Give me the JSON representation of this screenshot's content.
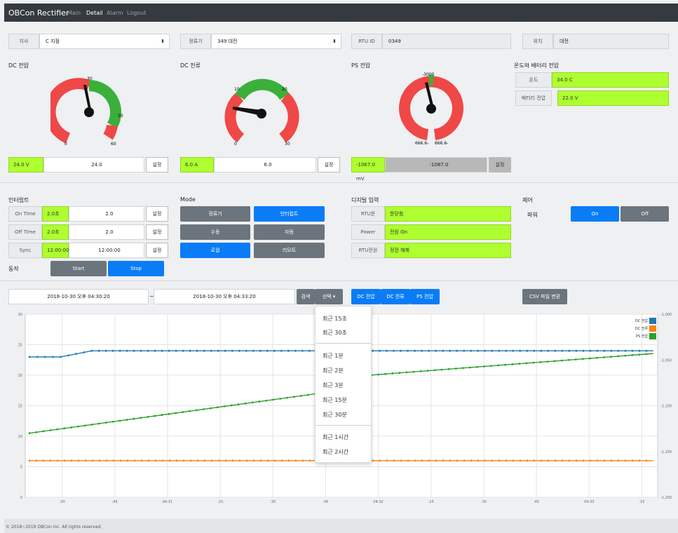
{
  "nav": {
    "brand": "OBCon Rectifier",
    "main": "Main",
    "detail": "Detail",
    "alarm": "Alarm",
    "logout": "Logout"
  },
  "filters": {
    "branch_label": "지사",
    "branch_value": "C 지점",
    "rect_label": "정류기",
    "rect_value": "349 대전",
    "rtu_label": "RTU ID",
    "rtu_value": "0349",
    "loc_label": "위치",
    "loc_value": "대전"
  },
  "gauges": {
    "dc_voltage": {
      "title": "DC 전압",
      "ticks": [
        "30",
        "50",
        "60",
        "0"
      ],
      "readout": "24.0 V",
      "input": "24.0",
      "set": "설정",
      "value": 24,
      "min": 0,
      "max": 60
    },
    "dc_current": {
      "title": "DC 전류",
      "ticks": [
        "10",
        "20",
        "30",
        "0"
      ],
      "readout": "6.0 A",
      "input": "6.0",
      "set": "설정",
      "value": 6,
      "min": 0,
      "max": 30
    },
    "ps_voltage": {
      "title": "PS 전압",
      "ticks": [
        "-3000",
        "666.6-",
        "666.6-"
      ],
      "readout": "-1067.0 mV",
      "input": "-1087.0",
      "set": "설정"
    }
  },
  "temp": {
    "title": "온도와 배터리 전압",
    "temp_label": "온도",
    "temp_value": "34.0 C",
    "batt_label": "배터리 전압",
    "batt_value": "22.0 V"
  },
  "interrupt": {
    "title": "인터럽트",
    "rows": [
      {
        "label": "On Time",
        "badge": "2.0초",
        "value": "2.0",
        "set": "설정"
      },
      {
        "label": "Off Time",
        "badge": "2.0초",
        "value": "2.0",
        "set": "설정"
      },
      {
        "label": "Sync",
        "badge": "12:00:00",
        "value": "12:00:00",
        "set": "설정"
      }
    ],
    "op_label": "동작",
    "start": "Start",
    "stop": "Stop"
  },
  "mode": {
    "title": "Mode",
    "b1": "정류기",
    "b2": "인터럽트",
    "b3": "수동",
    "b4": "자동",
    "b5": "로컬",
    "b6": "리모트"
  },
  "digital": {
    "title": "디지털 입력",
    "rows": [
      {
        "label": "RTU문",
        "value": "문닫힘"
      },
      {
        "label": "Power",
        "value": "전원 On"
      },
      {
        "label": "RTU전원",
        "value": "정전 해제"
      }
    ]
  },
  "control": {
    "title": "제어",
    "label": "파워",
    "on": "On",
    "off": "Off"
  },
  "range": {
    "start": "2018-10-30 오후 04:30:20",
    "sep": "~",
    "end": "2018-10-30 오후 04:33:20",
    "search": "검색",
    "select": "선택 ▾",
    "dc_v": "DC 전압",
    "dc_c": "DC 전류",
    "ps_v": "PS 전압",
    "csv": "CSV 파일 변환"
  },
  "dropdown": {
    "g1": [
      "최근 15초",
      "최근 30초"
    ],
    "g2": [
      "최근 1분",
      "최근 2분",
      "최근 3분",
      "최근 15분",
      "최근 30분"
    ],
    "g3": [
      "최근 1시간",
      "최근 2시간"
    ]
  },
  "footer": "© 2018~2019 OBCon Inc. All rights reserved.",
  "chart_data": {
    "type": "line",
    "x_ticks": [
      ":30",
      ":45",
      "04:31",
      ":15",
      ":30",
      ":45",
      "04:32",
      ":15",
      ":30",
      ":45",
      "04:33",
      ":15"
    ],
    "ylim": [
      0,
      30
    ],
    "yticks": [
      0,
      5,
      10,
      15,
      20,
      25,
      30
    ],
    "y2lim": [
      -1200,
      -1000
    ],
    "y2ticks": [
      "-1,000",
      "-1,050",
      "-1,100",
      "-1,150",
      "-1,200"
    ],
    "legend": "top-right",
    "series": [
      {
        "name": "DC 전압",
        "color": "#1f77b4",
        "axis": "left",
        "points": [
          [
            0,
            23
          ],
          [
            5,
            23
          ],
          [
            10,
            24
          ],
          [
            100,
            24
          ]
        ]
      },
      {
        "name": "DC 전류",
        "color": "#ff7f0e",
        "axis": "left",
        "points": [
          [
            0,
            6
          ],
          [
            100,
            6
          ]
        ]
      },
      {
        "name": "PS 전압",
        "color": "#2ca02c",
        "axis": "right",
        "points": [
          [
            0,
            -1130
          ],
          [
            48,
            -1085
          ],
          [
            48,
            -1070
          ],
          [
            100,
            -1043
          ]
        ]
      }
    ]
  }
}
